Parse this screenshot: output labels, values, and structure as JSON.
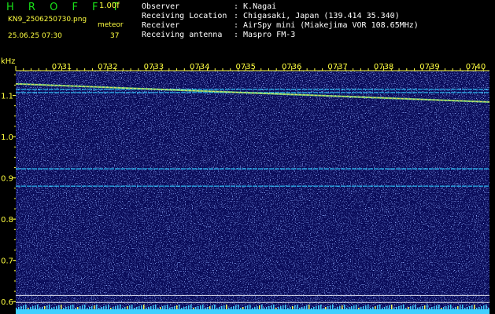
{
  "header": {
    "brand": "H R O F F T",
    "version": "1.00f",
    "filename": "KN9_2506250730.png",
    "meteor_label": "meteor",
    "datetime": "25.06.25 07:30",
    "meteor_count": "37",
    "info": [
      {
        "key": "Observer",
        "value": ": K.Nagai"
      },
      {
        "key": "Receiving Location",
        "value": ": Chigasaki, Japan (139.414 35.340)"
      },
      {
        "key": "Receiver",
        "value": ": AirSpy mini (Miakejima VOR 108.65MHz)"
      },
      {
        "key": "Receiving antenna",
        "value": ": Maspro FM-3"
      }
    ]
  },
  "chart_data": {
    "type": "heatmap",
    "ylabel": "kHz",
    "ytick_labels": [
      "1.1",
      "1.0",
      "0.9",
      "0.8",
      "0.7",
      "0.6"
    ],
    "ytick_values": [
      1.1,
      1.0,
      0.9,
      0.8,
      0.7,
      0.6
    ],
    "ylim": [
      0.57,
      1.16
    ],
    "xtick_labels": [
      "0731",
      "0732",
      "0733",
      "0734",
      "0735",
      "0736",
      "0737",
      "0738",
      "0739",
      "0740"
    ],
    "xtick_values": [
      1,
      2,
      3,
      4,
      5,
      6,
      7,
      8,
      9,
      10
    ],
    "xlim": [
      0,
      10.3
    ],
    "carriers_khz": [
      1.115,
      1.107,
      0.922,
      0.88,
      0.615,
      0.598
    ],
    "drifting_trace": {
      "start_khz": 1.128,
      "end_khz": 1.084
    },
    "colors": {
      "background": "#0a0c5a",
      "noise": "#4a70ff",
      "carrier": "#30c8ff",
      "trace": "#f0e060",
      "text": "#ffff40",
      "tick": "#ffff40"
    }
  }
}
